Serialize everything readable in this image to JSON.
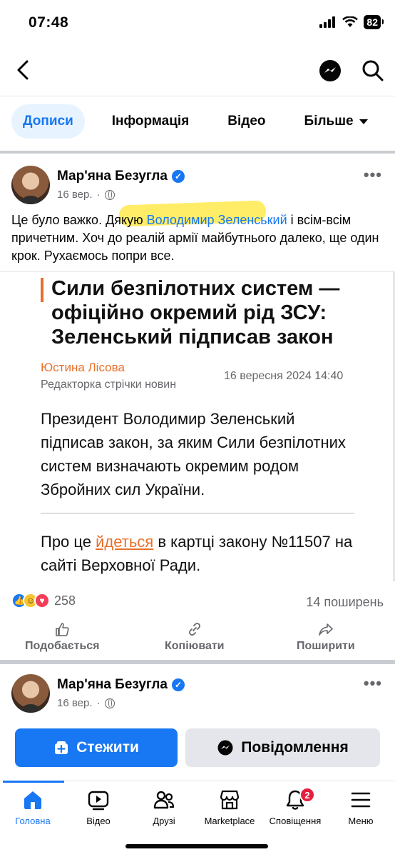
{
  "status_bar": {
    "time": "07:48",
    "battery": "82"
  },
  "tabs": [
    {
      "label": "Дописи"
    },
    {
      "label": "Інформація"
    },
    {
      "label": "Відео"
    },
    {
      "label": "Більше"
    }
  ],
  "post": {
    "author": "Мар'яна Безугла",
    "date": "16 вер.",
    "meta_sep": "·",
    "text_before": "Це було важко. Дякую ",
    "mention": "Володимир Зеленський",
    "text_after": " і всім-всім причетним. Хоч до реалій армії майбутнього далеко, ще один крок. Рухаємось попри все.",
    "article": {
      "title": "Сили безпілотних систем — офіційно окремий рід ЗСУ: Зеленський підписав закон",
      "author": "Юстина Лісова",
      "author_role": "Редакторка стрічки новин",
      "date": "16 вересня 2024 14:40",
      "body": "Президент Володимир Зеленський підписав закон, за яким Сили безпілотних систем визначають окремим родом Збройних сил України.",
      "footer_before": "Про це ",
      "footer_link": "йдеться",
      "footer_after": " в картці закону №11507 на сайті Верховної Ради."
    },
    "reactions_count": "258",
    "shares": "14 поширень",
    "actions": {
      "like": "Подобається",
      "copy": "Копіювати",
      "share": "Поширити"
    }
  },
  "second_post": {
    "author": "Мар'яна Безугла",
    "date": "16 вер.",
    "meta_sep": "·"
  },
  "buttons": {
    "follow": "Стежити",
    "message": "Повідомлення"
  },
  "bottom_nav": {
    "home": "Головна",
    "video": "Відео",
    "friends": "Друзі",
    "marketplace": "Marketplace",
    "notifications": "Сповіщення",
    "notifications_badge": "2",
    "menu": "Меню"
  },
  "colors": {
    "accent": "#1877f2",
    "article_accent": "#e8702a",
    "highlight": "#ffe628"
  }
}
